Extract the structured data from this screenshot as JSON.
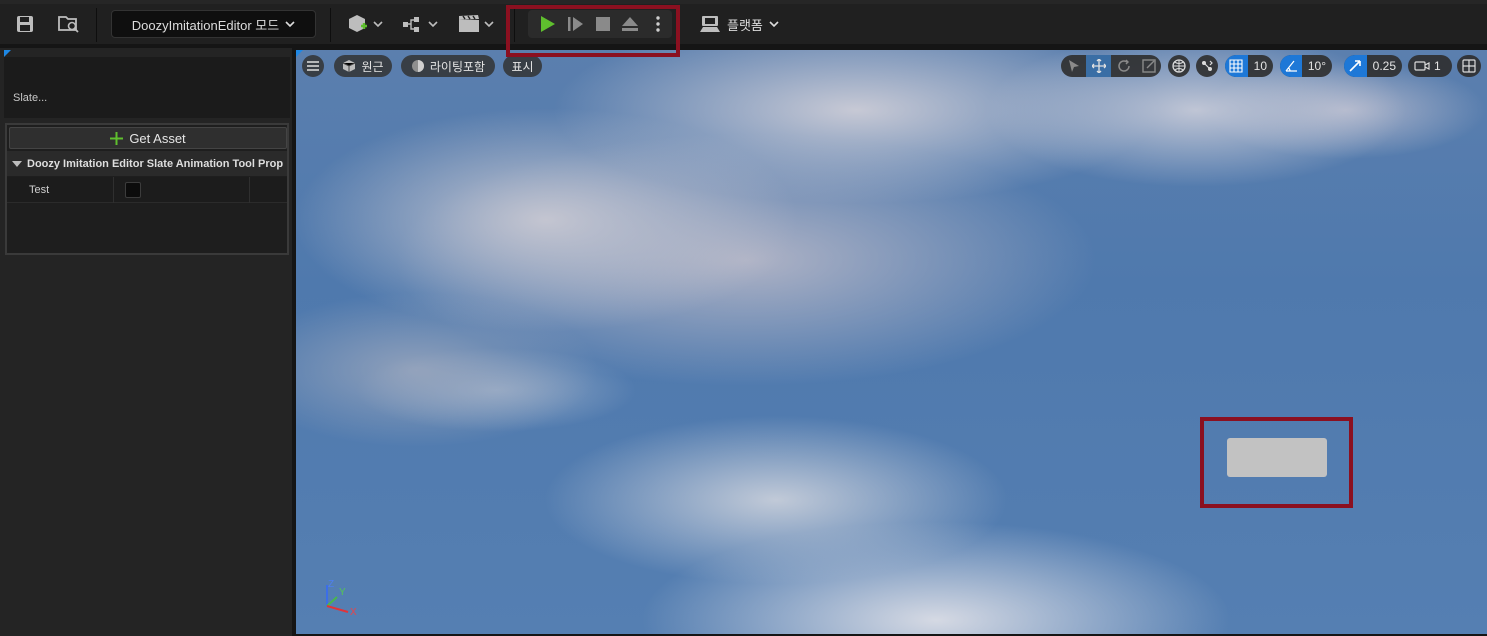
{
  "toolbar": {
    "mode_label": "DoozyImitationEditor 모드",
    "platform_label": "플랫폼",
    "icons": [
      "save-icon",
      "content-browser-icon",
      "add-actor-icon",
      "blueprint-icon",
      "cinematics-icon",
      "play-icon",
      "step-icon",
      "stop-icon",
      "eject-icon",
      "more-options-icon",
      "platform-icon"
    ]
  },
  "left_panel": {
    "slate_label": "Slate...",
    "get_asset_label": "Get Asset",
    "category_label": "Doozy Imitation Editor Slate Animation Tool Prop",
    "property_name": "Test",
    "property_value": false
  },
  "viewport": {
    "perspective_label": "원근",
    "lighting_label": "라이팅포함",
    "show_label": "표시",
    "grid_snap_value": "10",
    "rotation_snap_value": "10°",
    "scale_snap_value": "0.25",
    "camera_speed_value": "1",
    "axis_labels": {
      "z": "Z",
      "y": "Y",
      "x": "X"
    }
  },
  "colors": {
    "highlight_border": "#8b1020",
    "accent_blue": "#1e78d7",
    "play_green": "#5fbf2e"
  }
}
